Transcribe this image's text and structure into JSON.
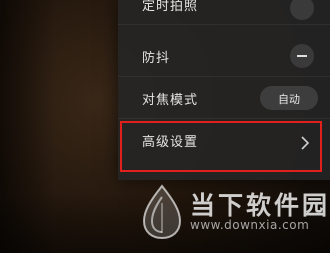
{
  "menu": {
    "items": [
      {
        "label": "定时拍照",
        "control": "toggle"
      },
      {
        "label": "防抖",
        "control": "toggle"
      },
      {
        "label": "对焦模式",
        "control": "value",
        "value": "自动"
      },
      {
        "label": "高级设置",
        "control": "chevron"
      }
    ],
    "highlight_color": "#e0201c"
  },
  "watermark": {
    "name": "当下软件园",
    "url": "www.downxia.com",
    "logo_icon": "leaf-drop-logo"
  }
}
